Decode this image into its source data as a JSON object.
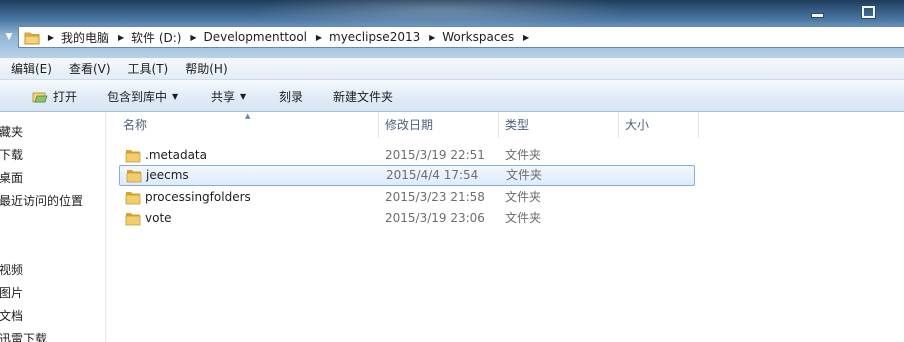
{
  "address_bar": {
    "crumbs": [
      "我的电脑",
      "软件 (D:)",
      "Developmenttool",
      "myeclipse2013",
      "Workspaces"
    ]
  },
  "menu": {
    "items": [
      "编辑(E)",
      "查看(V)",
      "工具(T)",
      "帮助(H)"
    ]
  },
  "toolbar": {
    "open_label": "打开",
    "include_library_label": "包含到库中",
    "share_label": "共享",
    "burn_label": "刻录",
    "new_folder_label": "新建文件夹"
  },
  "sidebar": {
    "items": [
      "藏夹",
      "下载",
      "桌面",
      "最近访问的位置",
      "视频",
      "图片",
      "文档",
      "迅雷下载"
    ]
  },
  "columns": {
    "name": "名称",
    "modified": "修改日期",
    "type": "类型",
    "size": "大小"
  },
  "files": [
    {
      "name": ".metadata",
      "modified": "2015/3/19 22:51",
      "type": "文件夹",
      "selected": false
    },
    {
      "name": "jeecms",
      "modified": "2015/4/4 17:54",
      "type": "文件夹",
      "selected": true
    },
    {
      "name": "processingfolders",
      "modified": "2015/3/23 21:58",
      "type": "文件夹",
      "selected": false
    },
    {
      "name": "vote",
      "modified": "2015/3/19 23:06",
      "type": "文件夹",
      "selected": false
    }
  ],
  "colors": {
    "selection_border": "#84acdd",
    "folder_yellow": "#e8b93c",
    "secondary_text": "#6d6d6d"
  }
}
